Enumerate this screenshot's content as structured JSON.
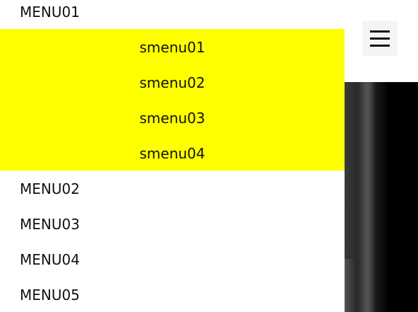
{
  "menu": {
    "items": [
      {
        "label": "MENU01"
      },
      {
        "label": "MENU02"
      },
      {
        "label": "MENU03"
      },
      {
        "label": "MENU04"
      },
      {
        "label": "MENU05"
      }
    ],
    "submenu": {
      "background": "#ffff00",
      "items": [
        {
          "label": "smenu01"
        },
        {
          "label": "smenu02"
        },
        {
          "label": "smenu03"
        },
        {
          "label": "smenu04"
        }
      ]
    }
  },
  "hamburger": {
    "icon": "hamburger-icon"
  },
  "hero": {
    "background": "#000000"
  }
}
